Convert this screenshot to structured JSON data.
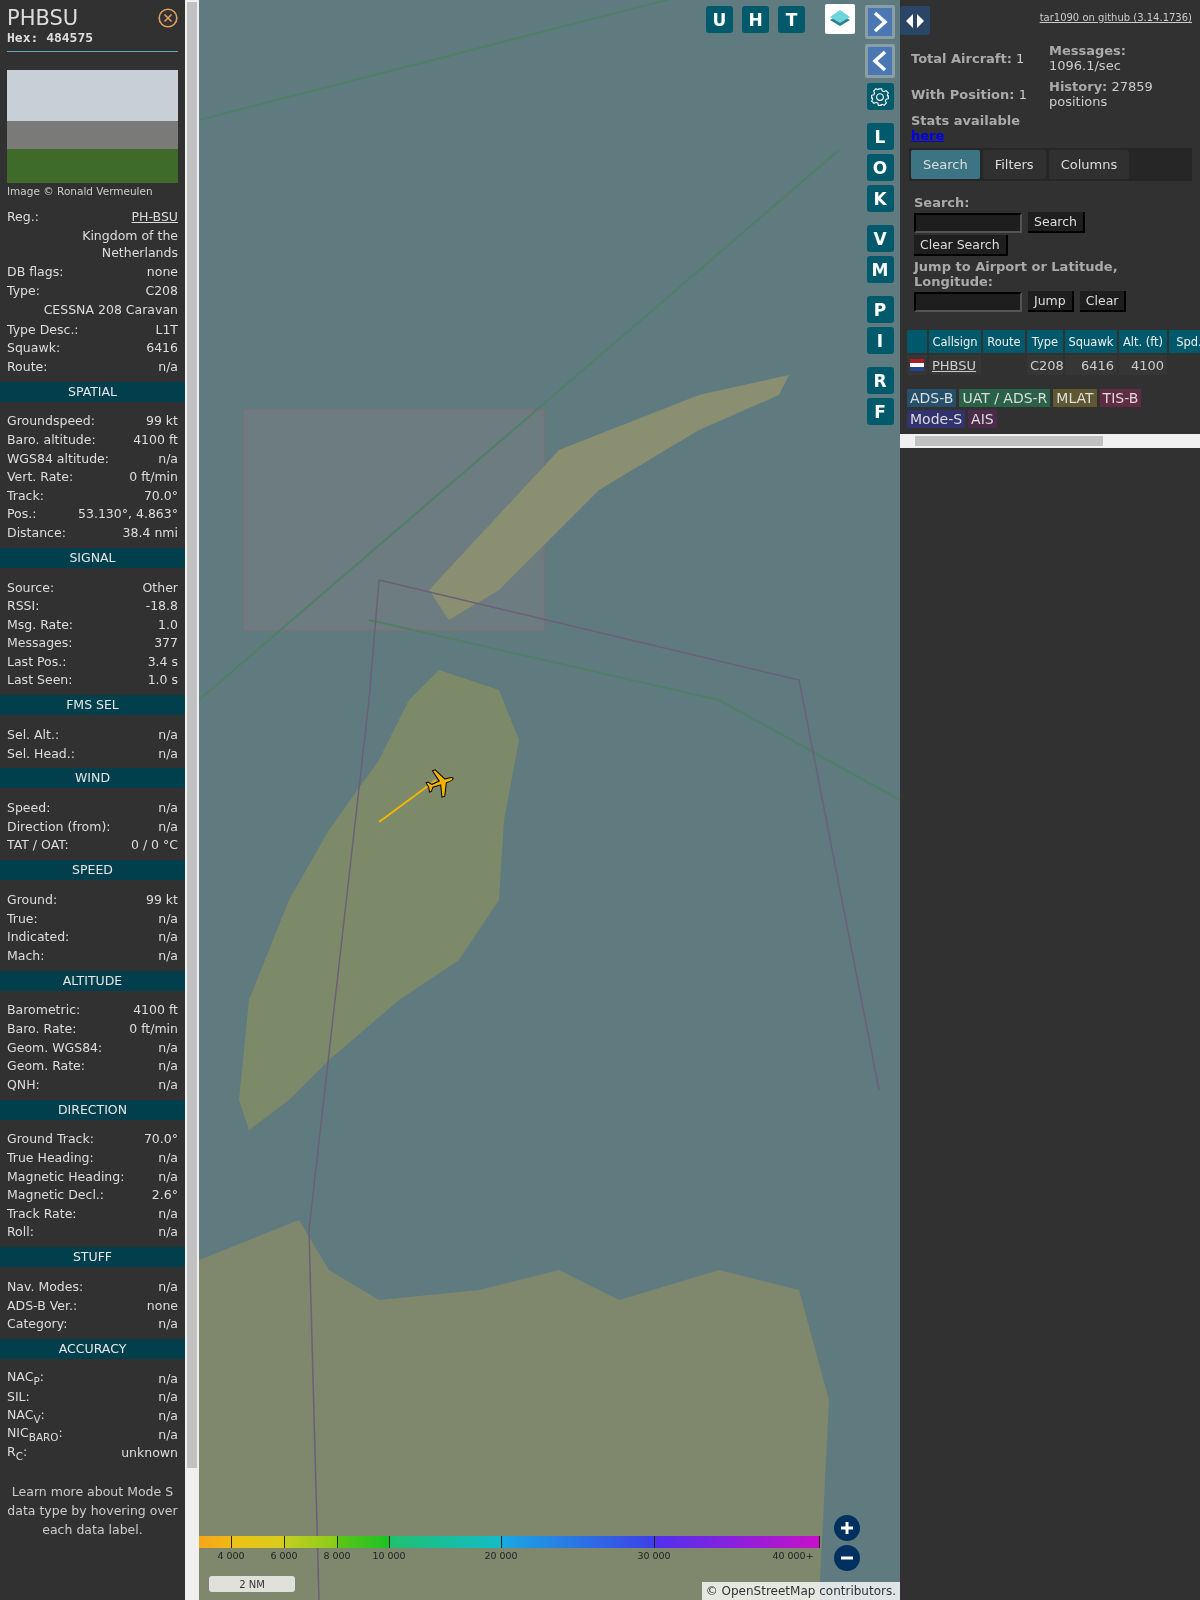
{
  "sidebar": {
    "title": "PHBSU",
    "hex_label": "Hex:",
    "hex": "484575",
    "photo_credit": "Image © Ronald Vermeulen",
    "rows": [
      {
        "kind": "link",
        "label": "Reg.:",
        "value": "PH-BSU"
      },
      {
        "kind": "note",
        "value": "Kingdom of the Netherlands"
      },
      {
        "kind": "pair",
        "label": "DB flags:",
        "value": "none"
      },
      {
        "kind": "pair",
        "label": "Type:",
        "value": "C208"
      },
      {
        "kind": "note",
        "value": "CESSNA 208 Caravan"
      },
      {
        "kind": "pair",
        "label": "Type Desc.:",
        "value": "L1T"
      },
      {
        "kind": "pair",
        "label": "Squawk:",
        "value": "6416"
      },
      {
        "kind": "pair",
        "label": "Route:",
        "value": "n/a"
      }
    ],
    "sections": [
      {
        "title": "SPATIAL",
        "rows": [
          {
            "label": "Groundspeed:",
            "value": "99 kt"
          },
          {
            "label": "Baro. altitude:",
            "value": "4100 ft"
          },
          {
            "label": "WGS84 altitude:",
            "value": "n/a"
          },
          {
            "label": "Vert. Rate:",
            "value": "0 ft/min"
          },
          {
            "label": "Track:",
            "value": "70.0°"
          },
          {
            "label": "Pos.:",
            "value": "53.130°, 4.863°"
          },
          {
            "label": "Distance:",
            "value": "38.4 nmi"
          }
        ]
      },
      {
        "title": "SIGNAL",
        "rows": [
          {
            "label": "Source:",
            "value": "Other"
          },
          {
            "label": "RSSI:",
            "value": "-18.8"
          },
          {
            "label": "Msg. Rate:",
            "value": "1.0"
          },
          {
            "label": "Messages:",
            "value": "377"
          },
          {
            "label": "Last Pos.:",
            "value": "3.4 s"
          },
          {
            "label": "Last Seen:",
            "value": "1.0 s"
          }
        ]
      },
      {
        "title": "FMS SEL",
        "rows": [
          {
            "label": "Sel. Alt.:",
            "value": "n/a"
          },
          {
            "label": "Sel. Head.:",
            "value": "n/a"
          }
        ]
      },
      {
        "title": "WIND",
        "rows": [
          {
            "label": "Speed:",
            "value": "n/a"
          },
          {
            "label": "Direction (from):",
            "value": "n/a"
          },
          {
            "label": "TAT / OAT:",
            "value": "0 / 0 °C"
          }
        ]
      },
      {
        "title": "SPEED",
        "rows": [
          {
            "label": "Ground:",
            "value": "99 kt"
          },
          {
            "label": "True:",
            "value": "n/a"
          },
          {
            "label": "Indicated:",
            "value": "n/a"
          },
          {
            "label": "Mach:",
            "value": "n/a"
          }
        ]
      },
      {
        "title": "ALTITUDE",
        "rows": [
          {
            "label": "Barometric:",
            "value": "4100 ft"
          },
          {
            "label": "Baro. Rate:",
            "value": "0 ft/min"
          },
          {
            "label": "Geom. WGS84:",
            "value": "n/a"
          },
          {
            "label": "Geom. Rate:",
            "value": "n/a"
          },
          {
            "label": "QNH:",
            "value": "n/a"
          }
        ]
      },
      {
        "title": "DIRECTION",
        "rows": [
          {
            "label": "Ground Track:",
            "value": "70.0°"
          },
          {
            "label": "True Heading:",
            "value": "n/a"
          },
          {
            "label": "Magnetic Heading:",
            "value": "n/a"
          },
          {
            "label": "Magnetic Decl.:",
            "value": "2.6°"
          },
          {
            "label": "Track Rate:",
            "value": "n/a"
          },
          {
            "label": "Roll:",
            "value": "n/a"
          }
        ]
      },
      {
        "title": "STUFF",
        "rows": [
          {
            "label": "Nav. Modes:",
            "value": "n/a"
          },
          {
            "label": "ADS-B Ver.:",
            "value": "none"
          },
          {
            "label": "Category:",
            "value": "n/a"
          }
        ]
      },
      {
        "title": "ACCURACY",
        "rows": [
          {
            "label": "NAC$_{P}$:",
            "value": "n/a"
          },
          {
            "label": "SIL:",
            "value": "n/a"
          },
          {
            "label": "NAC$_{V}$:",
            "value": "n/a"
          },
          {
            "label": "NIC$_{BARO}$:",
            "value": "n/a"
          },
          {
            "label": "R$_{C}$:",
            "value": "unknown"
          }
        ]
      }
    ],
    "footer": "Learn more about Mode S data type by hovering over each data label."
  },
  "map": {
    "buttons_top": [
      "U",
      "H",
      "T"
    ],
    "buttons_side": [
      [
        "L",
        "O",
        "K"
      ],
      [
        "V",
        "M"
      ],
      [
        "P",
        "I"
      ],
      [
        "R",
        "F"
      ]
    ],
    "altitude_legend": [
      "4 000",
      "6 000",
      "8 000",
      "10 000",
      "20 000",
      "30 000",
      "40 000+"
    ],
    "scale": "2 NM",
    "attribution": {
      "prefix": "©",
      "link": "OpenStreetMap",
      "suffix": "contributors."
    }
  },
  "panel": {
    "github_link": "tar1090 on github (3.14.1736)",
    "stats": [
      {
        "label": "Total Aircraft:",
        "value": "1"
      },
      {
        "label": "With Position:",
        "value": "1"
      },
      {
        "label": "Messages:",
        "value": "1096.1/sec"
      },
      {
        "label": "History:",
        "value": "27859 positions"
      }
    ],
    "stats_note": "Stats available",
    "stats_link": "here",
    "tabs": [
      {
        "label": "Search",
        "selected": true
      },
      {
        "label": "Filters",
        "selected": false
      },
      {
        "label": "Columns",
        "selected": false
      }
    ],
    "search_label": "Search:",
    "search_button": "Search",
    "clear_search_button": "Clear Search",
    "jump_label": "Jump to Airport or Latitude, Longitude:",
    "jump_button": "Jump",
    "clear_button": "Clear",
    "table": {
      "columns": [
        "Callsign",
        "Route",
        "Type",
        "Squawk",
        "Alt. (ft)",
        "Spd."
      ],
      "rows": [
        {
          "cells": [
            "PHBSU",
            null,
            "C208",
            "6416",
            "4100",
            null
          ]
        }
      ]
    },
    "sources": [
      {
        "label": "ADS-B",
        "color": "#26506a"
      },
      {
        "label": "UAT / ADS-R",
        "color": "#2a6148"
      },
      {
        "label": "MLAT",
        "color": "#5e5732"
      },
      {
        "label": "TIS-B",
        "color": "#602c43"
      },
      {
        "label": "Mode-S",
        "color": "#32326e"
      },
      {
        "label": "AIS",
        "color": "#4c2a4a"
      }
    ]
  }
}
